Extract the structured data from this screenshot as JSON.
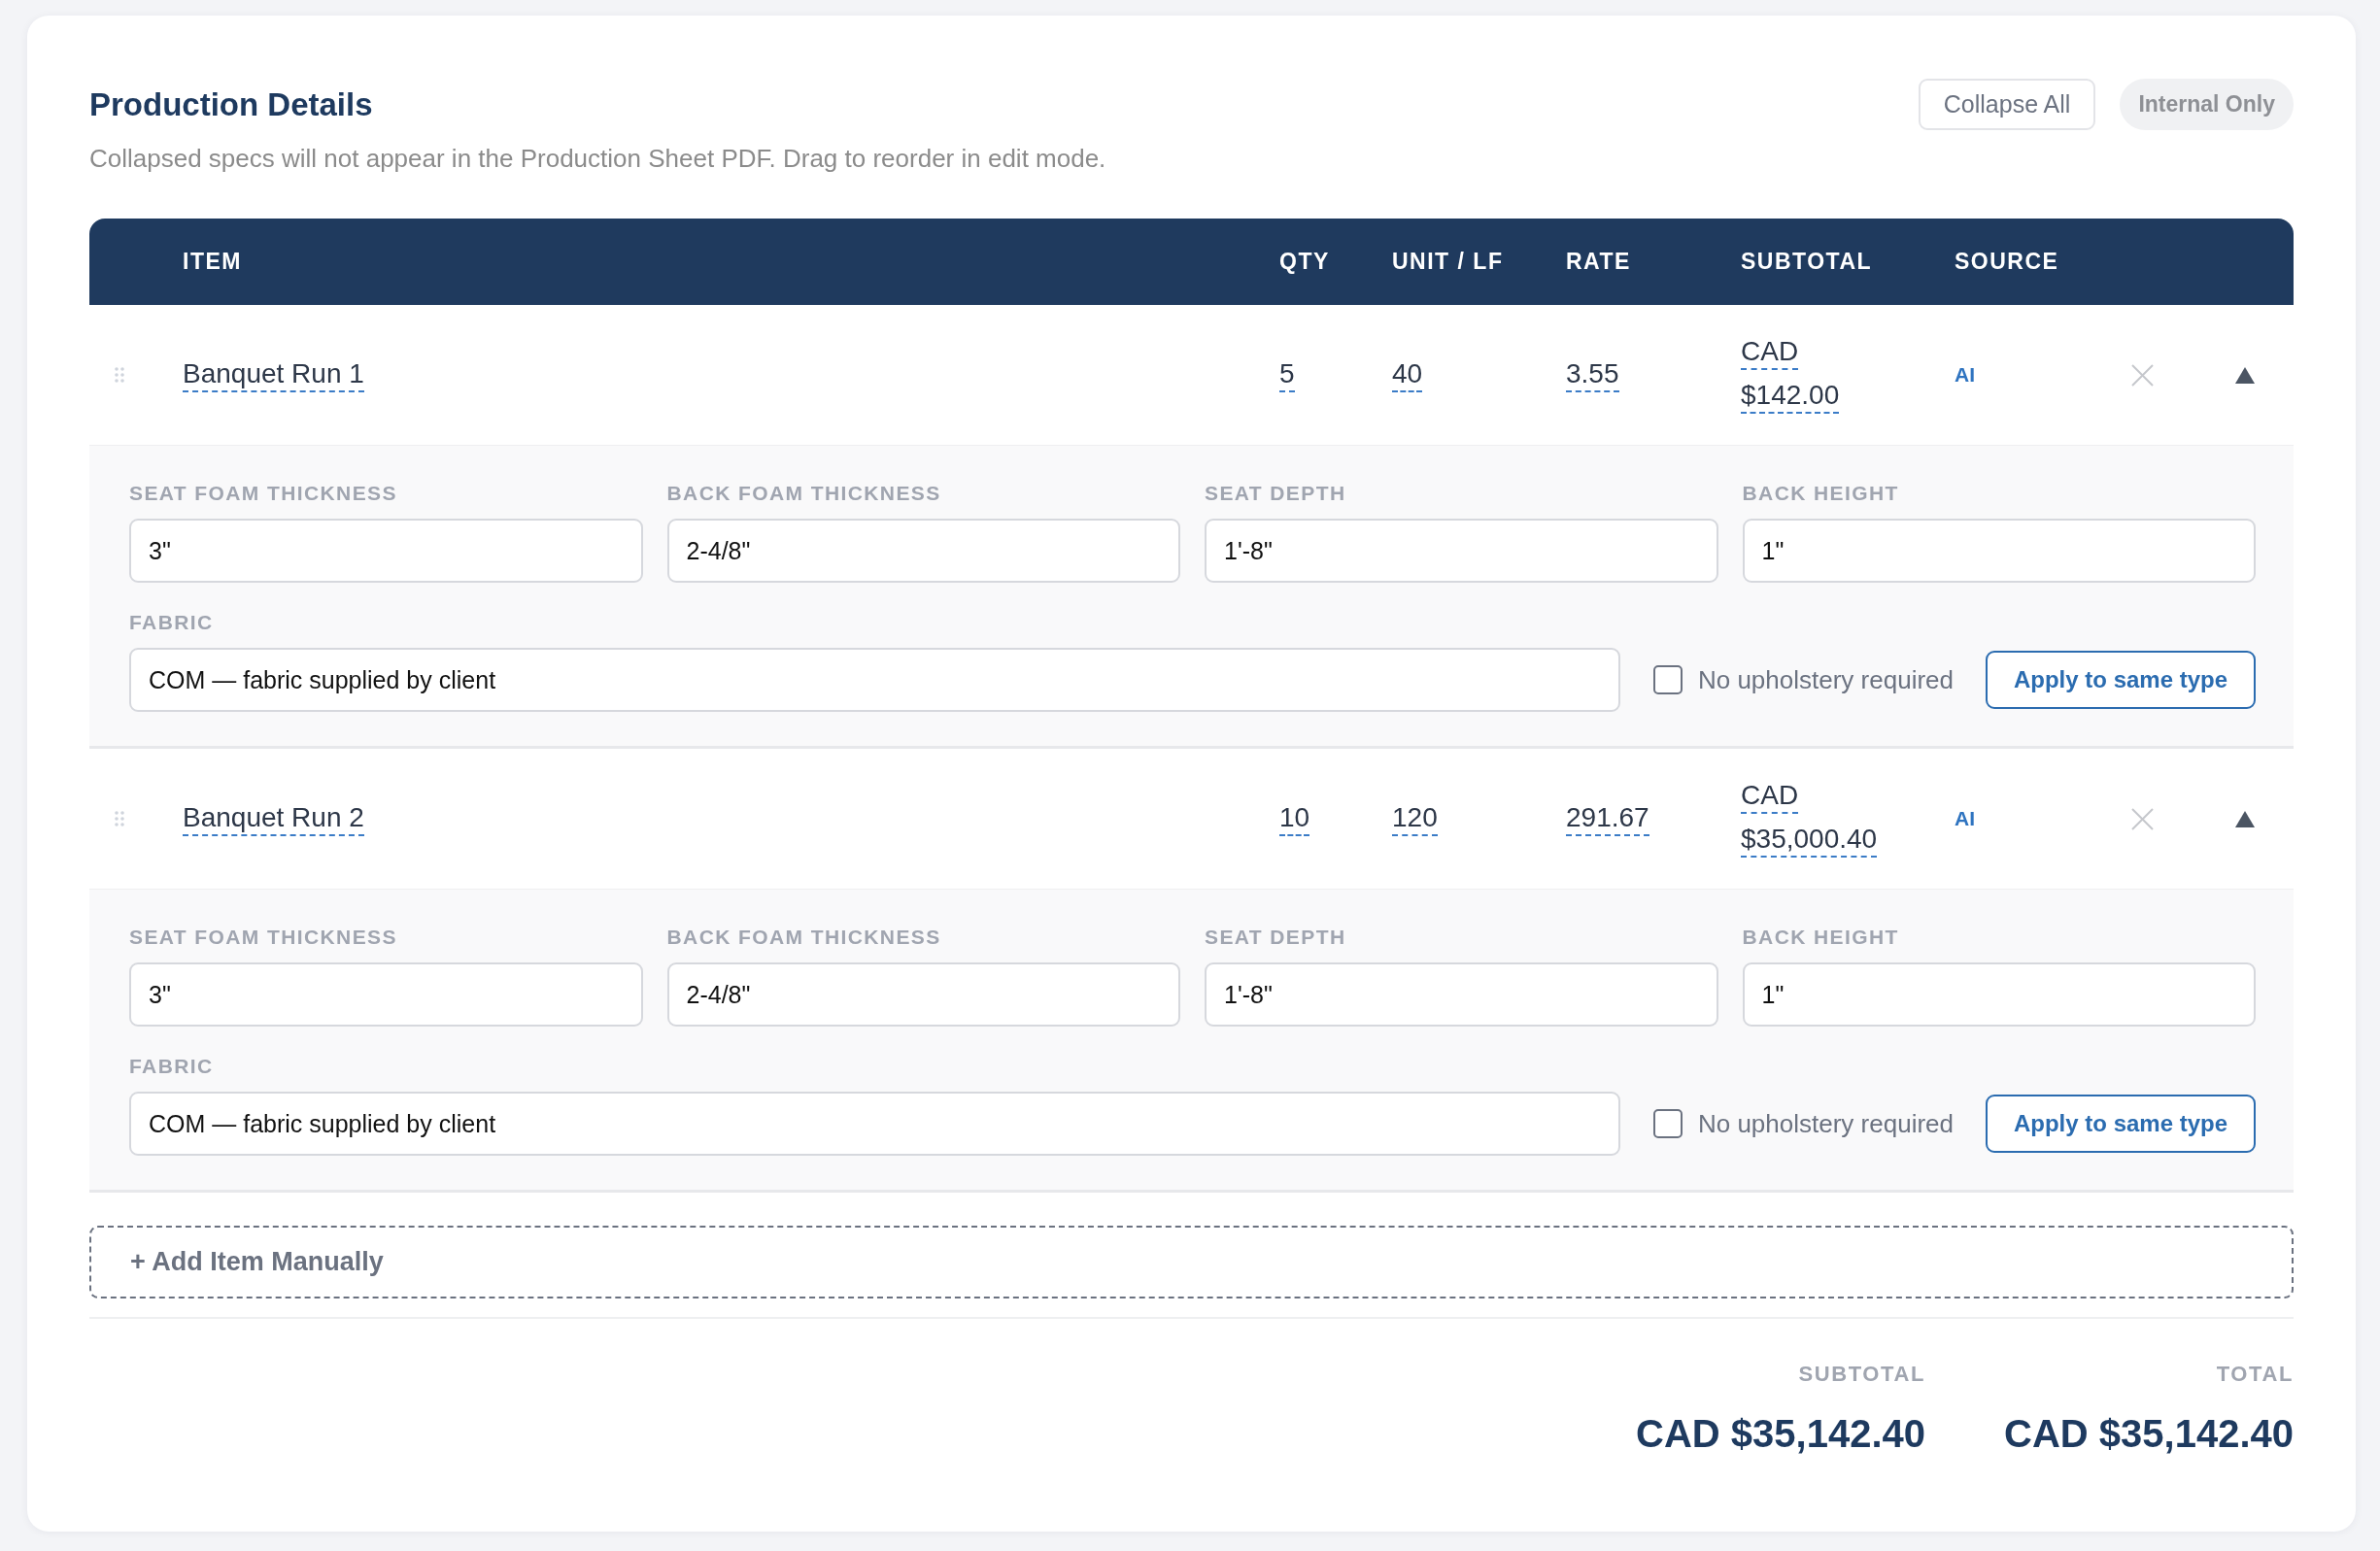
{
  "header": {
    "title": "Production Details",
    "subtitle": "Collapsed specs will not appear in the Production Sheet PDF. Drag to reorder in edit mode.",
    "collapse_button": "Collapse All",
    "badge": "Internal Only"
  },
  "table": {
    "columns": [
      "ITEM",
      "QTY",
      "UNIT / LF",
      "RATE",
      "SUBTOTAL",
      "SOURCE"
    ],
    "rows": [
      {
        "item": "Banquet Run 1",
        "qty": "5",
        "unit_lf": "40",
        "rate": "3.55",
        "subtotal": {
          "currency": "CAD",
          "amount": "$142.00"
        },
        "source": "AI",
        "expanded": true,
        "specs": [
          {
            "label": "SEAT FOAM THICKNESS",
            "value": "3\""
          },
          {
            "label": "BACK FOAM THICKNESS",
            "value": "2-4/8\""
          },
          {
            "label": "SEAT DEPTH",
            "value": "1'-8\""
          },
          {
            "label": "BACK HEIGHT",
            "value": "1\""
          }
        ],
        "fabric": {
          "label": "FABRIC",
          "value": "COM — fabric supplied by client"
        },
        "no_upholstery": {
          "label": "No upholstery required",
          "checked": false
        },
        "apply_button": "Apply to same type"
      },
      {
        "item": "Banquet Run 2",
        "qty": "10",
        "unit_lf": "120",
        "rate": "291.67",
        "subtotal": {
          "currency": "CAD",
          "amount": "$35,000.40"
        },
        "source": "AI",
        "expanded": true,
        "specs": [
          {
            "label": "SEAT FOAM THICKNESS",
            "value": "3\""
          },
          {
            "label": "BACK FOAM THICKNESS",
            "value": "2-4/8\""
          },
          {
            "label": "SEAT DEPTH",
            "value": "1'-8\""
          },
          {
            "label": "BACK HEIGHT",
            "value": "1\""
          }
        ],
        "fabric": {
          "label": "FABRIC",
          "value": "COM — fabric supplied by client"
        },
        "no_upholstery": {
          "label": "No upholstery required",
          "checked": false
        },
        "apply_button": "Apply to same type"
      }
    ]
  },
  "add_item": "+ Add Item Manually",
  "totals": [
    {
      "label": "SUBTOTAL",
      "value": "CAD $35,142.40"
    },
    {
      "label": "TOTAL",
      "value": "CAD $35,142.40"
    }
  ]
}
